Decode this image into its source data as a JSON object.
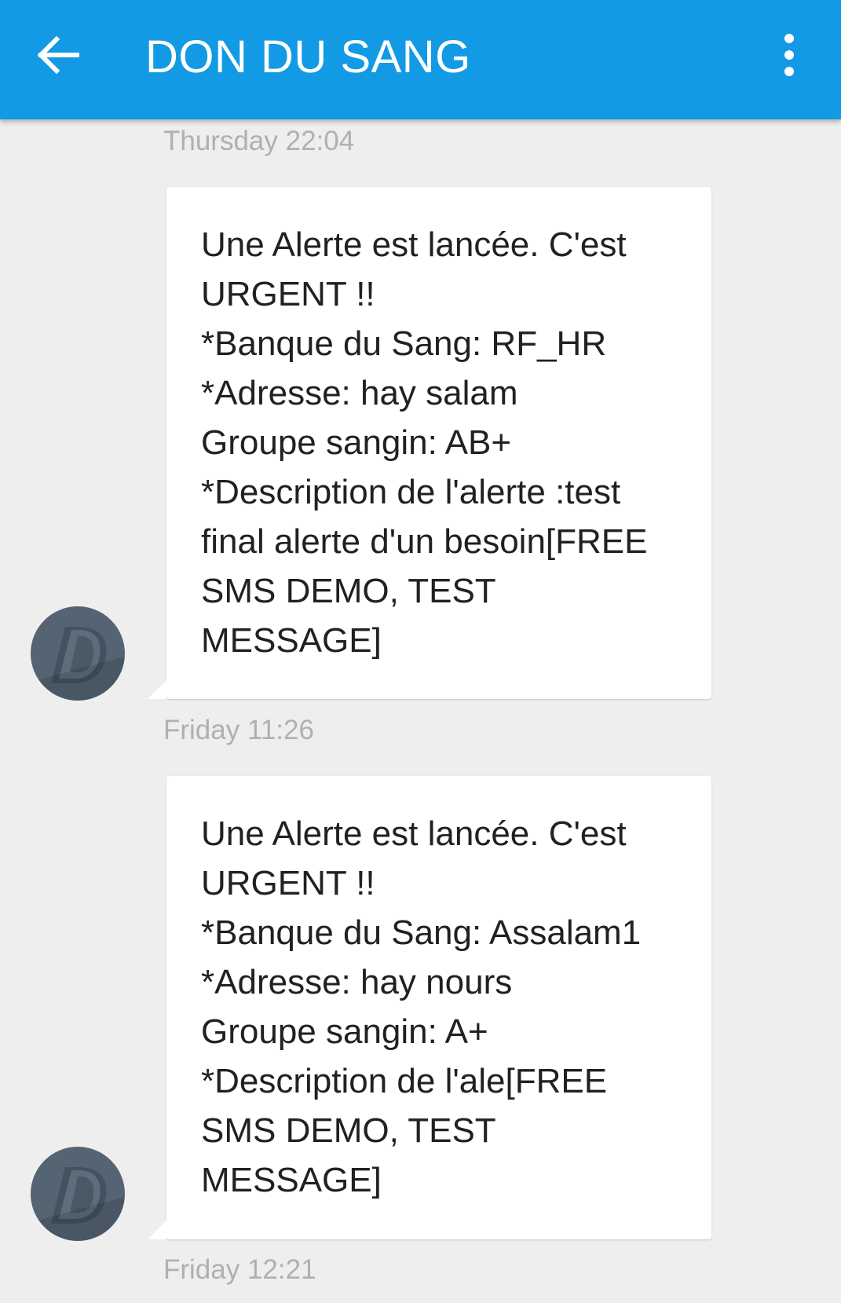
{
  "app_bar": {
    "title": "DON DU SANG",
    "back_icon": "arrow-back-icon",
    "menu_icon": "more-vert-icon",
    "color": "#129ae4"
  },
  "conversation": {
    "messages": [
      {
        "timestamp": "Thursday 22:04",
        "sender_initial": "D",
        "text": "Une Alerte est lancée. C'est\nURGENT !!\n*Banque du Sang: RF_HR\n*Adresse: hay salam\nGroupe sangin: AB+\n*Description de l'alerte :test\nfinal alerte d'un besoin[FREE\nSMS DEMO, TEST\nMESSAGE]"
      },
      {
        "timestamp": "Friday 11:26",
        "sender_initial": "D",
        "text": "Une Alerte est lancée. C'est\nURGENT !!\n*Banque du Sang: Assalam1\n*Adresse: hay nours\nGroupe sangin: A+\n*Description de l'ale[FREE\nSMS DEMO, TEST\nMESSAGE]"
      }
    ],
    "last_timestamp": "Friday 12:21"
  }
}
